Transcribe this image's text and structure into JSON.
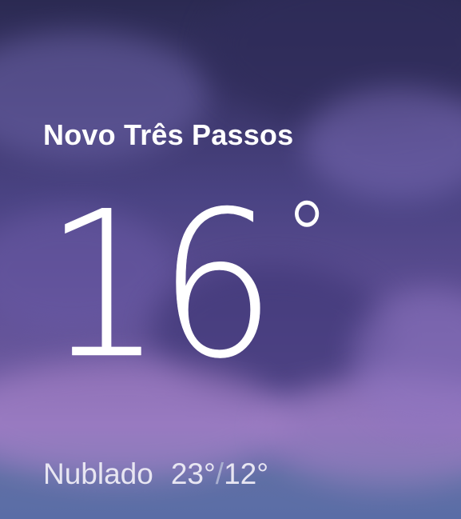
{
  "weather": {
    "location": "Novo Três Passos",
    "temperature": "16",
    "degree_symbol": "°",
    "condition": "Nublado",
    "high": "23°",
    "separator": "/",
    "low": "12°"
  },
  "colors": {
    "text": "#ffffff",
    "secondary_text": "#e8e6f2",
    "separator": "#aab0d0",
    "sky_top": "#2b2a52",
    "sky_middle": "#5a4c90",
    "sky_bottom": "#5a6da6"
  }
}
